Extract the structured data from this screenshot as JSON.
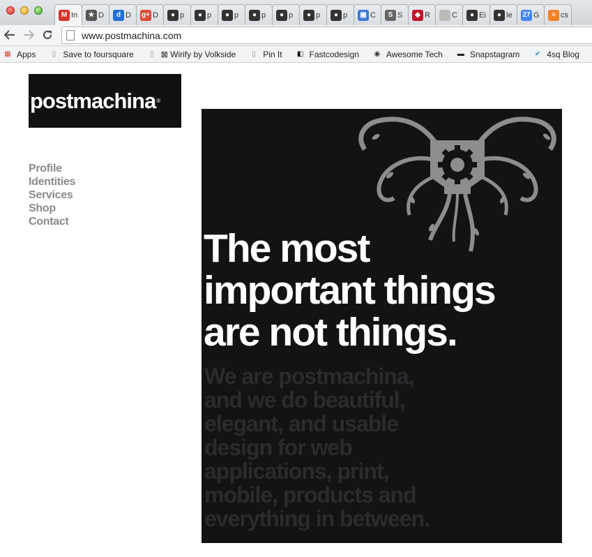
{
  "browser": {
    "tabs": [
      {
        "icon": "gmail-icon",
        "label": "In",
        "color": "#d93025",
        "glyph": "M"
      },
      {
        "icon": "star-circle-icon",
        "label": "D",
        "color": "#555555",
        "glyph": "★"
      },
      {
        "icon": "d-letter-icon",
        "label": "D",
        "color": "#1f6fd6",
        "glyph": "d"
      },
      {
        "icon": "google-plus-icon",
        "label": "D",
        "color": "#dd4b39",
        "glyph": "g+"
      },
      {
        "icon": "github-icon",
        "label": "p",
        "color": "#333333",
        "glyph": "●"
      },
      {
        "icon": "github-icon",
        "label": "p",
        "color": "#333333",
        "glyph": "●"
      },
      {
        "icon": "github-icon",
        "label": "p",
        "color": "#333333",
        "glyph": "●"
      },
      {
        "icon": "github-icon",
        "label": "p",
        "color": "#333333",
        "glyph": "●"
      },
      {
        "icon": "github-icon",
        "label": "p",
        "color": "#333333",
        "glyph": "●"
      },
      {
        "icon": "github-icon",
        "label": "p",
        "color": "#333333",
        "glyph": "●"
      },
      {
        "icon": "github-icon",
        "label": "p",
        "color": "#333333",
        "glyph": "●"
      },
      {
        "icon": "window-icon",
        "label": "C",
        "color": "#3b7bd6",
        "glyph": "▣"
      },
      {
        "icon": "s-logo-icon",
        "label": "S",
        "color": "#666666",
        "glyph": "S"
      },
      {
        "icon": "ruby-icon",
        "label": "R",
        "color": "#c0152a",
        "glyph": "◆"
      },
      {
        "icon": "page-icon",
        "label": "C",
        "color": "#bbbbbb",
        "glyph": ""
      },
      {
        "icon": "github-icon",
        "label": "Ei",
        "color": "#333333",
        "glyph": "●"
      },
      {
        "icon": "github-icon",
        "label": "le",
        "color": "#333333",
        "glyph": "●"
      },
      {
        "icon": "calendar-icon",
        "label": "G",
        "color": "#4285f4",
        "glyph": "27"
      },
      {
        "icon": "stack-icon",
        "label": "cs",
        "color": "#f48024",
        "glyph": "≡"
      }
    ],
    "url": "www.postmachina.com",
    "bookmarks": [
      {
        "icon": "apps-grid-icon",
        "label": "Apps"
      },
      {
        "icon": "page-icon",
        "label": "Save to foursquare"
      },
      {
        "icon": "page-icon",
        "label": "⊠ Wirify by Volkside"
      },
      {
        "icon": "page-icon",
        "label": "Pin It"
      },
      {
        "icon": "fastcodesign-icon",
        "label": "Fastcodesign"
      },
      {
        "icon": "awesome-tech-icon",
        "label": "Awesome Tech"
      },
      {
        "icon": "snapstagram-icon",
        "label": "Snapstagram"
      },
      {
        "icon": "foursquare-check-icon",
        "label": "4sq Blog"
      }
    ]
  },
  "site": {
    "logo_text": "postmachina",
    "logo_mark": "®",
    "nav": [
      "Profile",
      "Identities",
      "Services",
      "Shop",
      "Contact"
    ],
    "headline": [
      "The most",
      "important things",
      "are not things."
    ],
    "subtext": [
      "We are postmachina,",
      "and we do beautiful,",
      "elegant, and usable",
      "design for web",
      "applications, print,",
      "mobile, products and",
      "everything in between."
    ]
  },
  "colors": {
    "poster_bg": "#121314",
    "nav_text": "#8a8a8a",
    "subtext": "#2a2b2d",
    "illustration": "#8c8d8f"
  }
}
